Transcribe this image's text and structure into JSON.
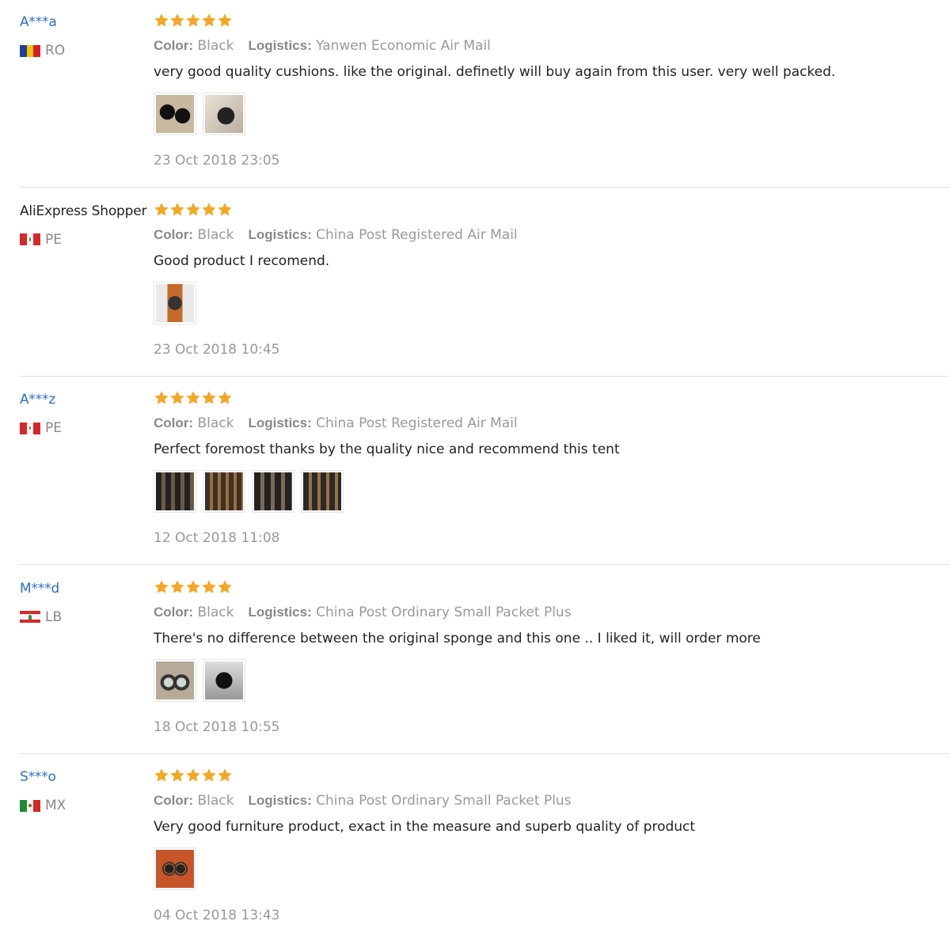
{
  "colors": {
    "accent": "#2a6fc9",
    "star": "#f5a623",
    "divider": "#e2e2e2",
    "muted": "#999999"
  },
  "labels": {
    "color": "Color:",
    "logistics": "Logistics:"
  },
  "reviews": [
    {
      "user": "A***a",
      "user_is_link": true,
      "country": "RO",
      "flag": "ro",
      "stars": 5,
      "color": "Black",
      "logistics": "Yanwen Economic Air Mail",
      "text": "very good quality cushions. like the original. definetly will buy again from this user. very well packed.",
      "photos": [
        "two black ear cushions photo",
        "single ear cushion photo"
      ],
      "date": "23 Oct 2018 23:05"
    },
    {
      "user": "AliExpress Shopper",
      "user_is_link": false,
      "country": "PE",
      "flag": "pe",
      "stars": 5,
      "color": "Black",
      "logistics": "China Post Registered Air Mail",
      "text": "Good product I recomend.",
      "photos": [
        "headphone cushion photo"
      ],
      "date": "23 Oct 2018 10:45"
    },
    {
      "user": "A***z",
      "user_is_link": true,
      "country": "PE",
      "flag": "pe",
      "stars": 5,
      "color": "Black",
      "logistics": "China Post Registered Air Mail",
      "text": "Perfect foremost thanks by the quality nice and recommend this tent",
      "photos": [
        "cushions photo 1",
        "cushions photo 2",
        "cushions photo 3",
        "cushions photo 4"
      ],
      "date": "12 Oct 2018 11:08"
    },
    {
      "user": "M***d",
      "user_is_link": true,
      "country": "LB",
      "flag": "lb",
      "stars": 5,
      "color": "Black",
      "logistics": "China Post Ordinary Small Packet Plus",
      "text": "There's no difference between the original sponge and this one .. I liked it, will order more",
      "photos": [
        "headphones with cushions photo",
        "dark cushion photo"
      ],
      "date": "18 Oct 2018 10:55"
    },
    {
      "user": "S***o",
      "user_is_link": true,
      "country": "MX",
      "flag": "mx",
      "stars": 5,
      "color": "Black",
      "logistics": "China Post Ordinary Small Packet Plus",
      "text": "Very good furniture product, exact in the measure and superb quality of product",
      "photos": [
        "cushions on orange background photo"
      ],
      "date": "04 Oct 2018 13:43"
    }
  ]
}
